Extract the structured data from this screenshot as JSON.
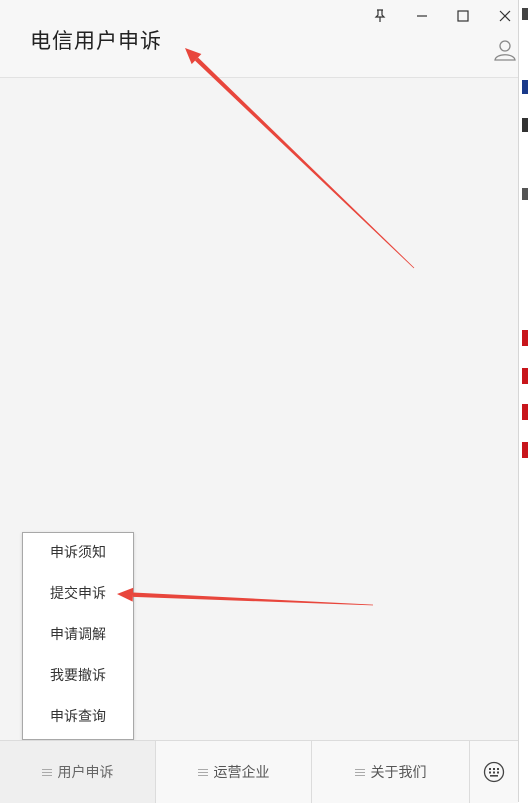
{
  "window": {
    "title": "电信用户申诉"
  },
  "icons": {
    "pin": "pin-icon",
    "minimize": "minimize-icon",
    "maximize": "maximize-icon",
    "close": "close-icon",
    "user": "user-icon",
    "keyboard": "keyboard-icon"
  },
  "popup_menu": {
    "items": [
      {
        "label": "申诉须知"
      },
      {
        "label": "提交申诉"
      },
      {
        "label": "申请调解"
      },
      {
        "label": "我要撤诉"
      },
      {
        "label": "申诉查询"
      }
    ]
  },
  "bottom_tabs": [
    {
      "label": "用户申诉",
      "active": true
    },
    {
      "label": "运营企业",
      "active": false
    },
    {
      "label": "关于我们",
      "active": false
    }
  ],
  "colors": {
    "annotation_arrow": "#e8463c"
  }
}
